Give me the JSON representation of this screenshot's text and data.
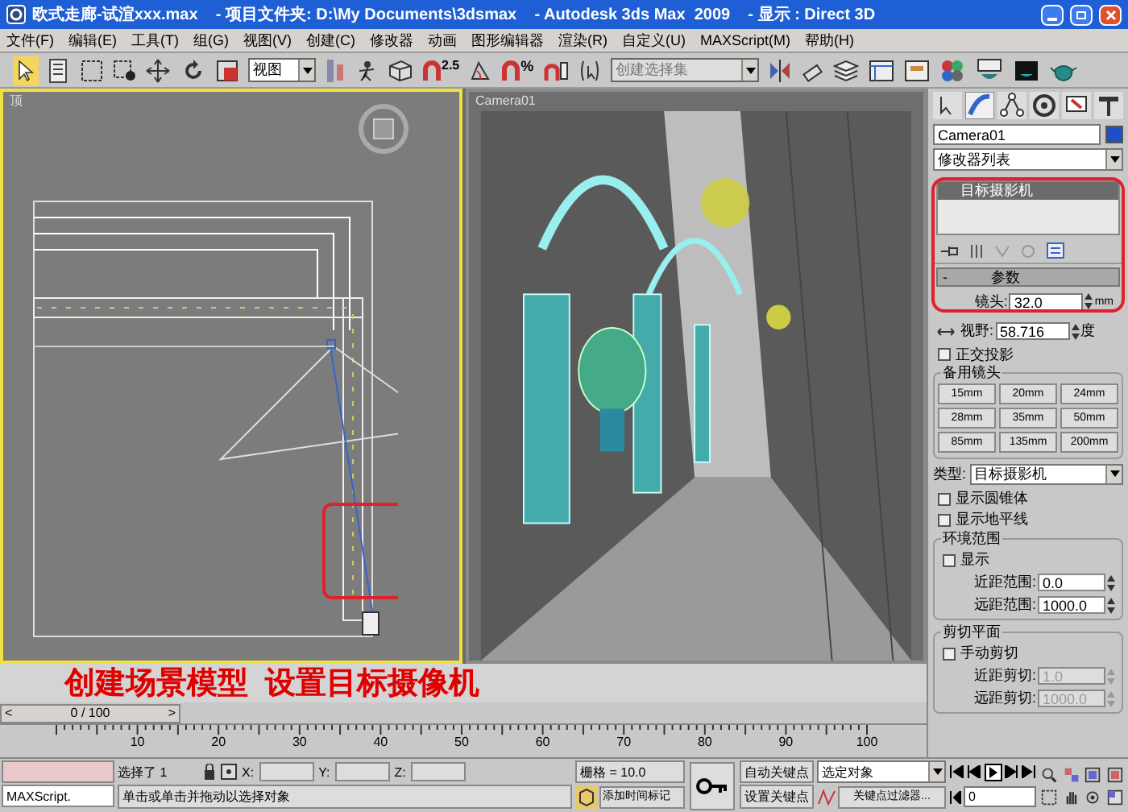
{
  "window": {
    "title": "欧式走廊-试渲xxx.max    - 项目文件夹: D:\\My Documents\\3dsmax    - Autodesk 3ds Max  2009    - 显示 : Direct 3D"
  },
  "menu": [
    "文件(F)",
    "编辑(E)",
    "工具(T)",
    "组(G)",
    "视图(V)",
    "创建(C)",
    "修改器",
    "动画",
    "图形编辑器",
    "渲染(R)",
    "自定义(U)",
    "MAXScript(M)",
    "帮助(H)"
  ],
  "toolbar": {
    "reference_coord": "视图",
    "snap_angle": "2.5",
    "snap_percent": "%",
    "selection_set": "创建选择集"
  },
  "viewports": [
    {
      "label": "顶",
      "selected": true
    },
    {
      "label": "Camera01",
      "selected": false
    }
  ],
  "annotation": "创建场景模型  设置目标摄像机",
  "command_panel": {
    "object_name": "Camera01",
    "modifier_list": "修改器列表",
    "stack_item": "目标摄影机",
    "rollout": "参数",
    "rollout_toggle": "-",
    "lens": {
      "label": "镜头:",
      "value": "32.0",
      "unit": "mm"
    },
    "fov": {
      "label": "视野:",
      "value": "58.716",
      "unit": "度"
    },
    "orthographic": {
      "label": "正交投影",
      "checked": false
    },
    "stock_lenses": {
      "title": "备用镜头",
      "buttons": [
        "15mm",
        "20mm",
        "24mm",
        "28mm",
        "35mm",
        "50mm",
        "85mm",
        "135mm",
        "200mm"
      ]
    },
    "type": {
      "label": "类型:",
      "value": "目标摄影机"
    },
    "options": [
      {
        "label": "显示圆锥体",
        "checked": false
      },
      {
        "label": "显示地平线",
        "checked": false
      }
    ],
    "env_ranges": {
      "title": "环境范围",
      "show": {
        "label": "显示",
        "checked": false
      },
      "fields": [
        {
          "label": "近距范围:",
          "value": "0.0",
          "disabled": false
        },
        {
          "label": "远距范围:",
          "value": "1000.0",
          "disabled": false
        }
      ]
    },
    "clipping": {
      "title": "剪切平面",
      "manual": {
        "label": "手动剪切",
        "checked": false
      },
      "fields": [
        {
          "label": "近距剪切:",
          "value": "1.0",
          "disabled": true
        },
        {
          "label": "远距剪切:",
          "value": "1000.0",
          "disabled": true
        }
      ]
    }
  },
  "time_slider": {
    "label": "0 / 100",
    "prev": "<",
    "next": ">"
  },
  "ruler": [
    "10",
    "20",
    "30",
    "40",
    "50",
    "60",
    "70",
    "80",
    "90",
    "100"
  ],
  "status": {
    "maxscript": "MAXScript.",
    "selected": "选择了 1",
    "x": "X:",
    "y": "Y:",
    "z": "Z:",
    "grid": "栅格 = 10.0",
    "prompt": "单击或单击并拖动以选择对象",
    "add_time_tag": "添加时间标记",
    "auto_key": "自动关键点",
    "set_key": "设置关键点",
    "key_target": "选定对象",
    "key_filters": "关键点过滤器...",
    "frame": "0"
  }
}
